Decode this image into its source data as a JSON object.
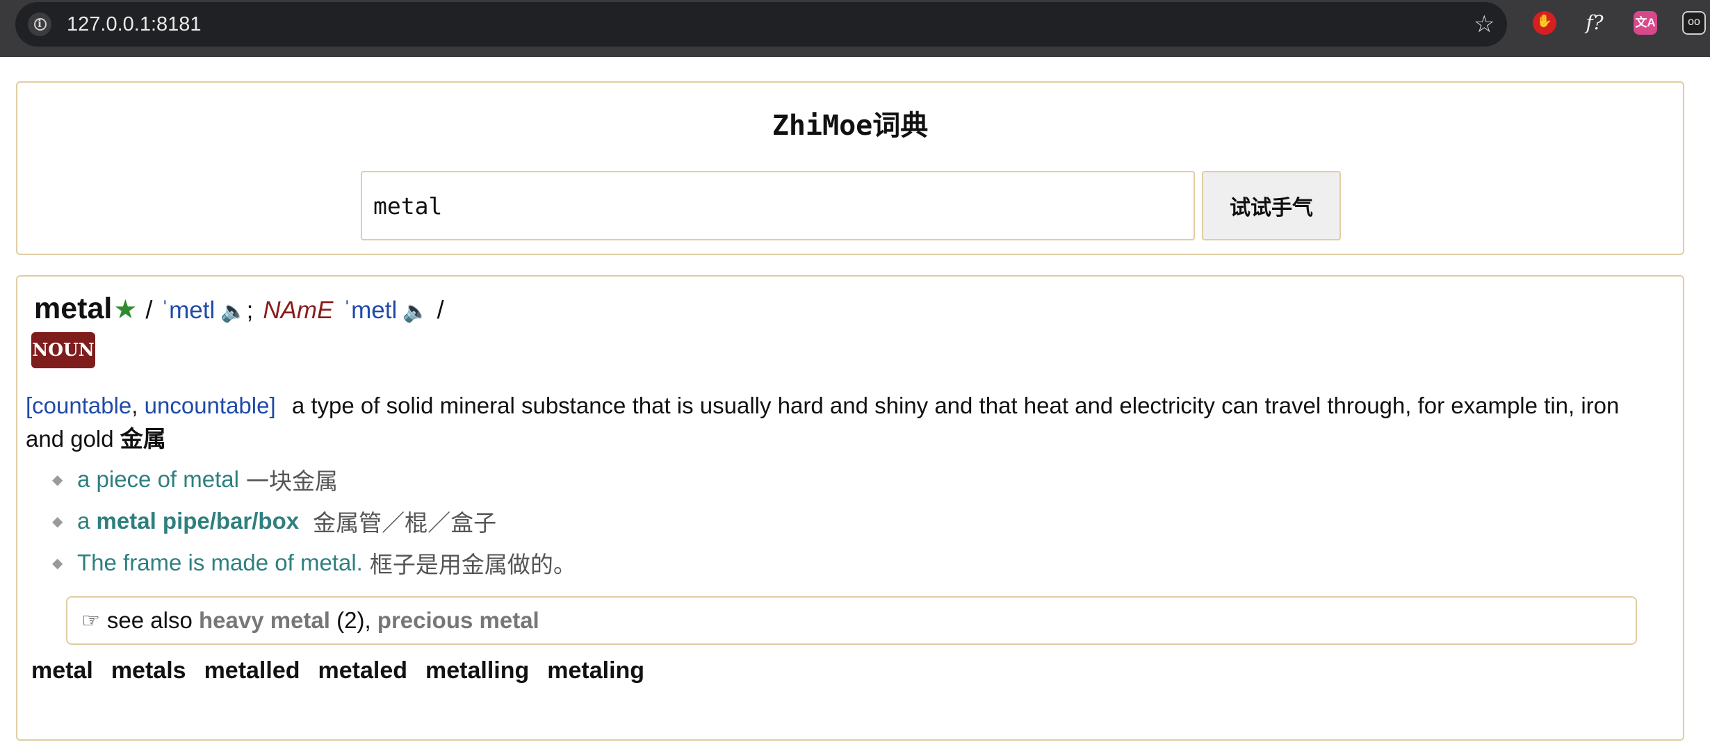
{
  "browser": {
    "url": "127.0.0.1:8181",
    "extensions": {
      "font": "f?",
      "translate": "文A",
      "eyes": "oo"
    }
  },
  "app": {
    "title": "ZhiMoe词典",
    "search_value": "metal",
    "search_button": "试试手气"
  },
  "entry": {
    "headword": "metal",
    "star": "★",
    "slash_open": "/",
    "pron_br": "ˈmetl",
    "semicolon": ";",
    "region": "NAmE",
    "pron_am": "ˈmetl",
    "slash_close": "/",
    "pos": "NOUN",
    "grammar_open": "[countable",
    "grammar_sep": ", ",
    "grammar_close": "uncountable]",
    "definition": "a type of solid mineral substance that is usually hard and shiny and that heat and electricity can travel through, for example tin, iron and gold",
    "definition_zh": "金属",
    "examples": [
      {
        "en": "a piece of metal",
        "zh": "一块金属"
      },
      {
        "prefix": "a ",
        "bold": "metal pipe/bar/box",
        "zh": "金属管／棍／盒子"
      },
      {
        "en": "The frame is made of metal.",
        "zh": "框子是用金属做的。"
      }
    ],
    "see_also_label": "see also",
    "see_also_1": "heavy metal",
    "see_also_1_num": "(2),",
    "see_also_2": "precious metal",
    "forms": [
      "metal",
      "metals",
      "metalled",
      "metaled",
      "metalling",
      "metaling"
    ]
  },
  "colors": {
    "panel_border": "#e0cda3",
    "pron_blue": "#1f4aa8",
    "region_red": "#8b1a1a",
    "pos_badge": "#7f1d1d",
    "example_teal": "#2f7f7f",
    "star_green": "#2e8b2e"
  },
  "icons": {
    "info": "info-icon",
    "bookmark": "star-icon",
    "speaker_br": "speaker-icon",
    "speaker_am": "speaker-icon",
    "pointer": "pointing-hand-icon"
  }
}
